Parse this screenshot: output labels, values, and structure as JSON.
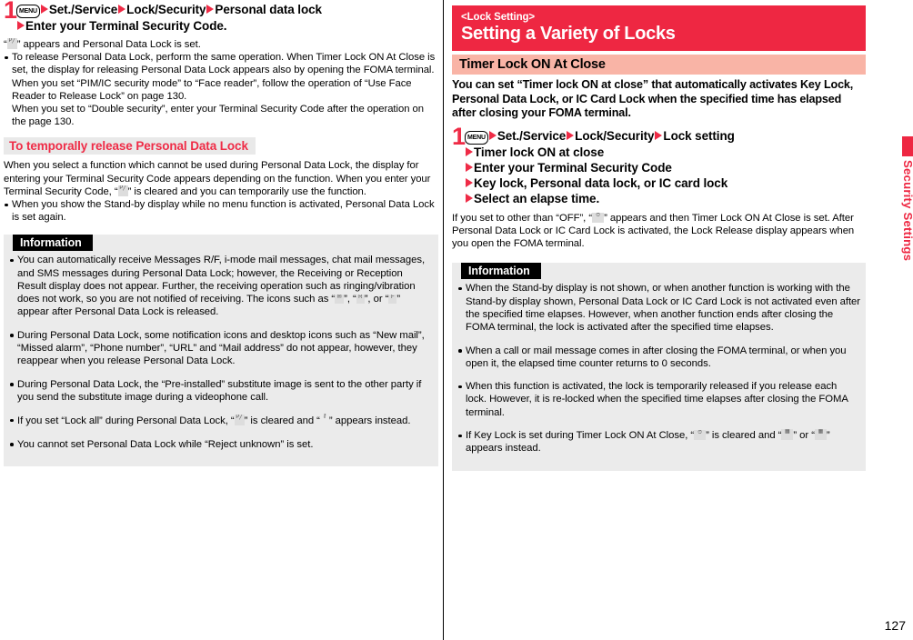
{
  "page": {
    "number": "127",
    "edge_tab_label": "Security Settings",
    "accent_red": "#ee2742",
    "step_num_red": "#ef2b46",
    "pink_band": "#f9b4a6",
    "info_bg": "#ebebeb",
    "gray_head_bg": "#e9e9e9"
  },
  "left": {
    "step1": {
      "number": "1",
      "menu_key": "MENU",
      "line1_items": [
        "Set./Service",
        "Lock/Security",
        "Personal data lock"
      ],
      "line2_items": [
        "Enter your Terminal Security Code."
      ]
    },
    "step1_notes": {
      "note_prefix": "“",
      "note_icon": "personal-data-lock-icon",
      "note_suffix": "” appears and Personal Data Lock is set.",
      "bullets": [
        "To release Personal Data Lock, perform the same operation. When Timer Lock ON At Close is set, the display for releasing Personal Data Lock appears also by opening the FOMA terminal.",
        "When you set “PIM/IC security mode” to “Face reader”, follow the operation of “Use Face Reader to Release Lock” on page 130.",
        "When you set to “Double security”, enter your Terminal Security Code after the operation on the page 130."
      ]
    },
    "section_heading": "To temporally release Personal Data Lock",
    "section_body": {
      "para_part1": "When you select a function which cannot be used during Personal Data Lock, the display for entering your Terminal Security Code appears depending on the function. When you enter your Terminal Security Code, “",
      "para_part2": "” is cleared and you can temporarily use the function.",
      "bullet1": "When you show the Stand-by display while no menu function is activated, Personal Data Lock is set again."
    },
    "information": {
      "heading": "Information",
      "items": [
        {
          "part1": "You can automatically receive Messages R/F, i-mode mail messages, chat mail messages, and SMS messages during Personal Data Lock; however, the Receiving or Reception Result display does not appear. Further, the receiving operation such as ringing/vibration does not work, so you are not notified of receiving. The icons such as “",
          "part2": "”, “",
          "part3": "”, or “",
          "part4": "” appear after Personal Data Lock is released."
        },
        {
          "text": "During Personal Data Lock, some notification icons and desktop icons such as “New mail”, “Missed alarm”, “Phone number”, “URL” and “Mail address” do not appear, however, they reappear when you release Personal Data Lock."
        },
        {
          "text": "During Personal Data Lock, the “Pre-installed” substitute image is sent to the other party if you send the substitute image during a videophone call."
        },
        {
          "part1": "If you set “Lock all” during Personal Data Lock, “",
          "part2": "” is cleared and “",
          "part3": "” appears instead."
        },
        {
          "text": "You cannot set Personal Data Lock while “Reject unknown” is set."
        }
      ]
    }
  },
  "right": {
    "banner": {
      "kicker": "<Lock Setting>",
      "title": "Setting a Variety of Locks"
    },
    "subsection_heading": "Timer Lock ON At Close",
    "lead": "You can set “Timer lock ON at close” that automatically activates Key Lock, Personal Data Lock, or IC Card Lock when the specified time has elapsed after closing your FOMA terminal.",
    "step1": {
      "number": "1",
      "menu_key": "MENU",
      "line1_items": [
        "Set./Service",
        "Lock/Security",
        "Lock setting"
      ],
      "line2_items": [
        "Timer lock ON at close"
      ],
      "line3_items": [
        "Enter your Terminal Security Code"
      ],
      "line4_items": [
        "Key lock, Personal data lock, or IC card lock"
      ],
      "line5_items": [
        "Select an elapse time."
      ]
    },
    "step1_notes": {
      "part1": "If you set to other than “OFF”, “",
      "part2": "” appears and then Timer Lock ON At Close is set. After Personal Data Lock or IC Card Lock is activated, the Lock Release display appears when you open the FOMA terminal."
    },
    "information": {
      "heading": "Information",
      "items": [
        {
          "text": "When the Stand-by display is not shown, or when another function is working with the Stand-by display shown, Personal Data Lock or IC Card Lock is not activated even after the specified time elapses. However, when another function ends after closing the FOMA terminal, the lock is activated after the specified time elapses."
        },
        {
          "text": "When a call or mail message comes in after closing the FOMA terminal, or when you open it, the elapsed time counter returns to 0 seconds."
        },
        {
          "text": "When this function is activated, the lock is temporarily released if you release each lock. However, it is re-locked when the specified time elapses after closing the FOMA terminal."
        },
        {
          "part1": "If Key Lock is set during Timer Lock ON At Close, “",
          "part2": "” is cleared and “",
          "part3": "” or “",
          "part4": "” appears instead."
        }
      ]
    }
  }
}
